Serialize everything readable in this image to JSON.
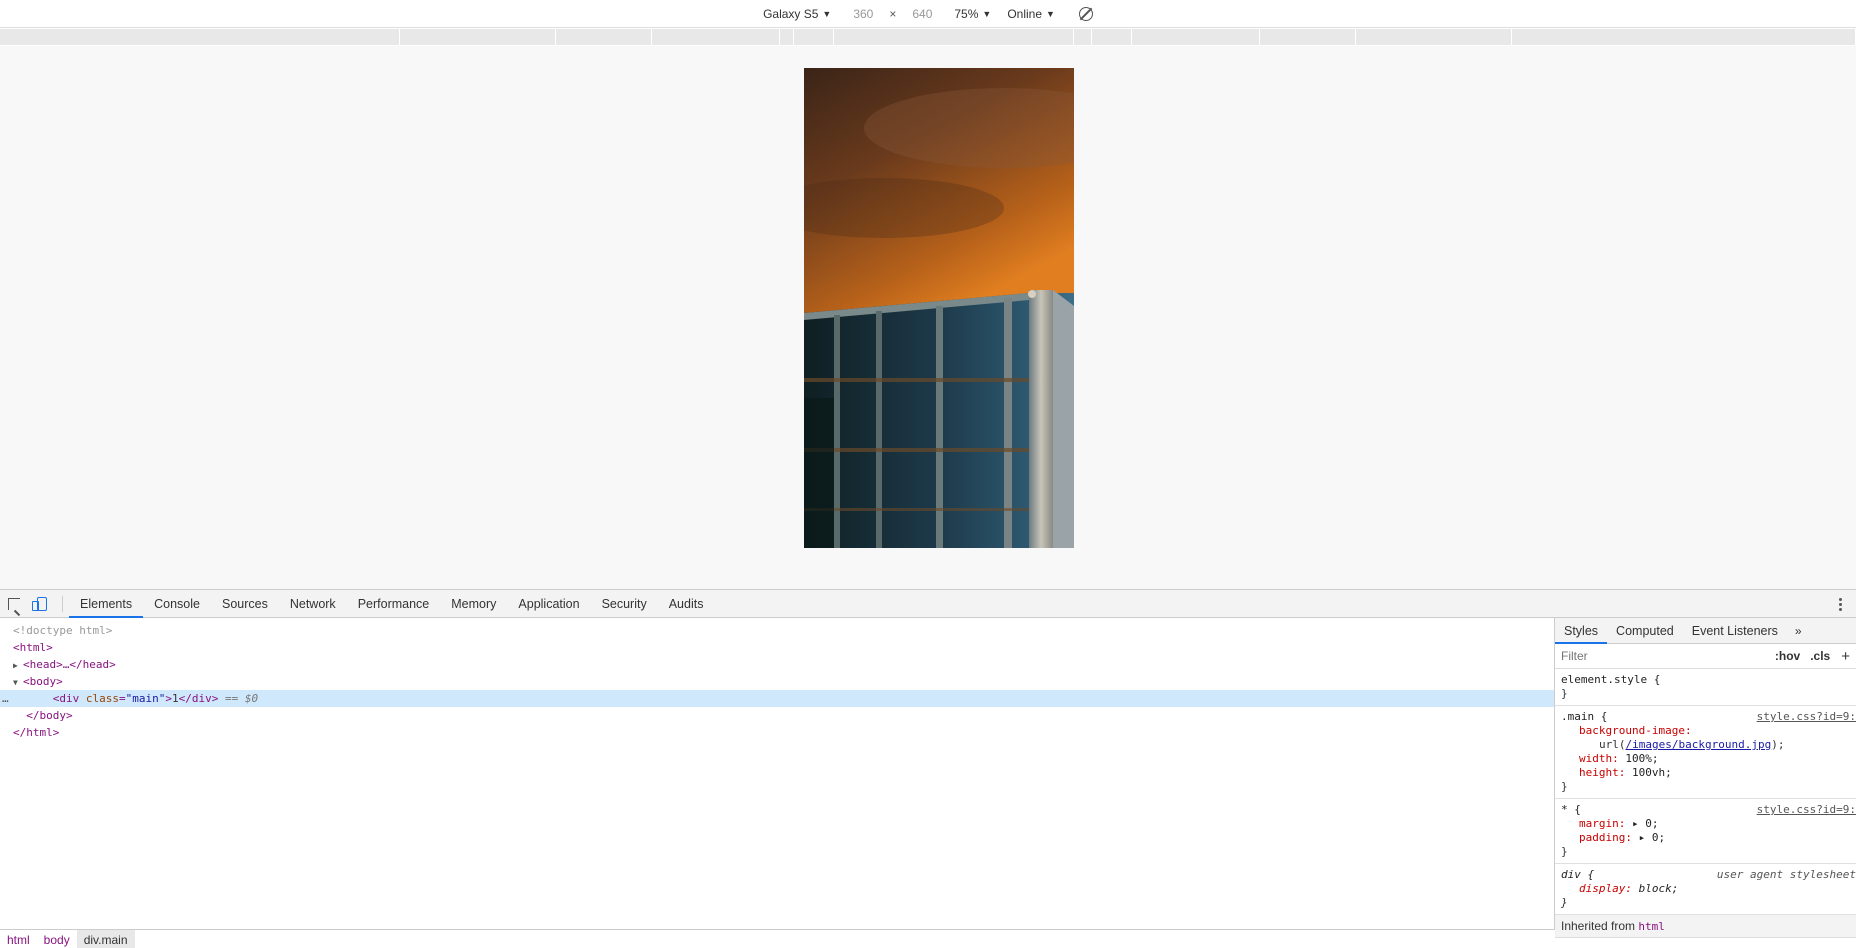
{
  "device_toolbar": {
    "device": "Galaxy S5",
    "width": "360",
    "times": "×",
    "height": "640",
    "zoom": "75%",
    "throttle": "Online"
  },
  "devtools": {
    "tabs": [
      "Elements",
      "Console",
      "Sources",
      "Network",
      "Performance",
      "Memory",
      "Application",
      "Security",
      "Audits"
    ],
    "active_tab": "Elements",
    "dom": {
      "doctype": "<!doctype html>",
      "html_open": "<html>",
      "head": "<head>…</head>",
      "body_open": "<body>",
      "div_open_tag": "div",
      "div_attr_name": "class",
      "div_attr_value": "\"main\"",
      "div_text": "1",
      "div_close": "</div>",
      "selected_marker": "== $0",
      "body_close": "</body>",
      "html_close": "</html>",
      "dots": "…"
    },
    "breadcrumb": [
      "html",
      "body",
      "div.main"
    ],
    "styles": {
      "tabs": [
        "Styles",
        "Computed",
        "Event Listeners"
      ],
      "more": "»",
      "filter_placeholder": "Filter",
      "hov": ":hov",
      "cls": ".cls",
      "plus": "+",
      "element_style": "element.style {",
      "close_brace": "}",
      "main_selector": ".main {",
      "main_source": "style.css?id=9:",
      "bg_image_name": "background-image:",
      "bg_url_prefix": "url(",
      "bg_url": "/images/background.jpg",
      "bg_url_suffix": ");",
      "width_name": "width:",
      "width_value": "100%;",
      "height_name": "height:",
      "height_value": "100vh;",
      "star_selector": "* {",
      "star_source": "style.css?id=9:",
      "margin_name": "margin:",
      "margin_value": "▸ 0;",
      "padding_name": "padding:",
      "padding_value": "▸ 0;",
      "div_selector": "div {",
      "div_source": "user agent stylesheet",
      "display_name": "display:",
      "display_value": "block;",
      "inherited_label": "Inherited from",
      "inherited_tag": "html"
    }
  },
  "colors": {
    "accent": "#1a73e8",
    "tag": "#881280",
    "selected_row": "#cfe8fc"
  }
}
